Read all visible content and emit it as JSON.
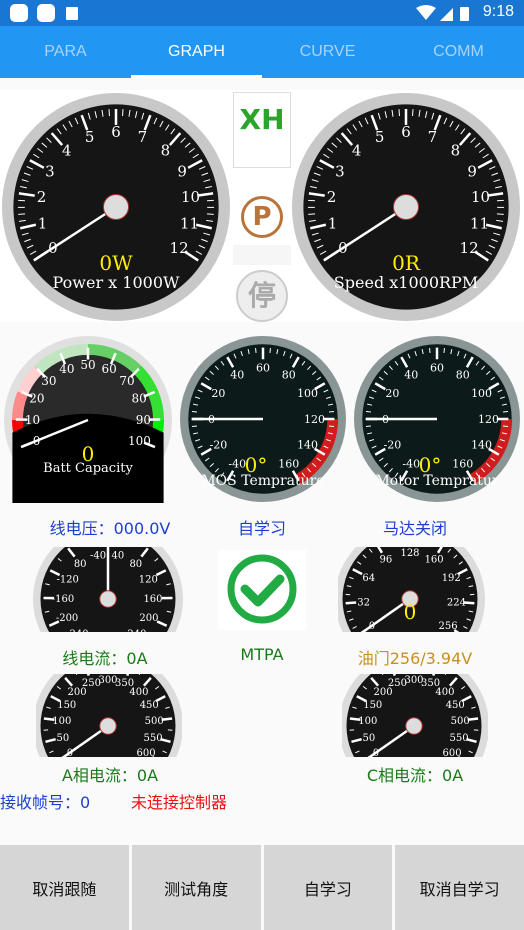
{
  "status_bar": {
    "time": "9:18",
    "icons": [
      "app-icon",
      "app-icon",
      "a-icon",
      "wifi-icon",
      "signal-icon",
      "battery-charging-icon"
    ]
  },
  "tabs": [
    {
      "label": "PARA"
    },
    {
      "label": "GRAPH",
      "active": true
    },
    {
      "label": "CURVE"
    },
    {
      "label": "COMM"
    }
  ],
  "center": {
    "xh": "XH",
    "park": "P",
    "stop": "停",
    "xh_color": "#2aa52a",
    "park_color": "#b8743a"
  },
  "gauges": {
    "power": {
      "labels": [
        "0",
        "1",
        "2",
        "3",
        "4",
        "5",
        "6",
        "7",
        "8",
        "9",
        "10",
        "11",
        "12"
      ],
      "value": 0,
      "value_text": "0W",
      "caption": "Power x 1000W"
    },
    "speed": {
      "labels": [
        "0",
        "1",
        "2",
        "3",
        "4",
        "5",
        "6",
        "7",
        "8",
        "9",
        "10",
        "11",
        "12"
      ],
      "value": 0,
      "value_text": "0R",
      "caption": "Speed x1000RPM"
    },
    "batt": {
      "labels": [
        "0",
        "10",
        "20",
        "30",
        "40",
        "50",
        "60",
        "70",
        "80",
        "90",
        "100"
      ],
      "value": 0,
      "value_text": "0",
      "caption": "Batt Capacity"
    },
    "mos": {
      "labels": [
        "-40",
        "-20",
        "0",
        "20",
        "40",
        "60",
        "80",
        "100",
        "120",
        "140",
        "160"
      ],
      "value": 0,
      "value_text": "0°",
      "caption": "MOS Temprature"
    },
    "motor": {
      "labels": [
        "-40",
        "-20",
        "0",
        "20",
        "40",
        "60",
        "80",
        "100",
        "120",
        "140",
        "160"
      ],
      "value": 0,
      "value_text": "0°",
      "caption": "Motor Tempratur"
    },
    "line_current": {
      "labels": [
        "240",
        "-200",
        "-160",
        "-120",
        "80",
        "-40",
        "40",
        "80",
        "120",
        "160",
        "200",
        "240"
      ],
      "value": 0
    },
    "throttle": {
      "labels": [
        "0",
        "32",
        "64",
        "96",
        "128",
        "160",
        "192",
        "224",
        "256"
      ],
      "value": 0,
      "value_text": "0"
    },
    "phase_a": {
      "labels": [
        "0",
        "50",
        "100",
        "150",
        "200",
        "250",
        "300",
        "350",
        "400",
        "450",
        "500",
        "550",
        "600"
      ],
      "value": 0
    },
    "phase_c": {
      "labels": [
        "0",
        "50",
        "100",
        "150",
        "200",
        "250",
        "300",
        "350",
        "400",
        "450",
        "500",
        "550",
        "600"
      ],
      "value": 0
    }
  },
  "labels": {
    "line_voltage": "线电压：000.0V",
    "self_learn": "自学习",
    "motor_state": "马达关闭",
    "line_current": "线电流：0A",
    "mtpa": "MTPA",
    "throttle": "油门256/3.94V",
    "phase_a": "A相电流：0A",
    "phase_c": "C相电流：0A",
    "frame_no": "接收帧号：0",
    "connection": "未连接控制器"
  },
  "buttons": [
    "取消跟随",
    "测试角度",
    "自学习",
    "取消自学习"
  ]
}
